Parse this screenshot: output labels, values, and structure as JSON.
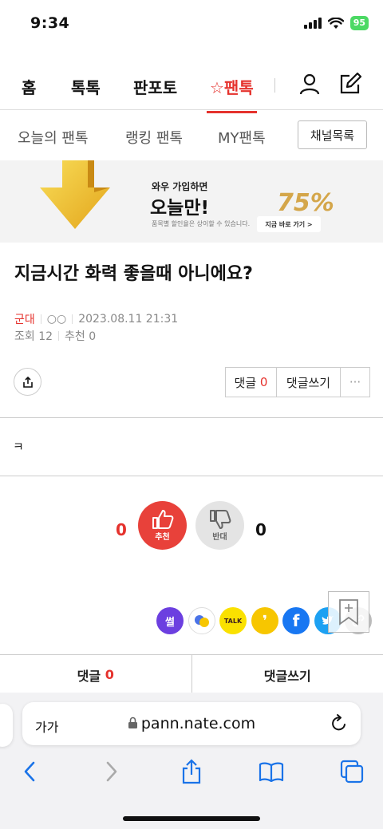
{
  "status_bar": {
    "time": "9:34",
    "battery": "95"
  },
  "top_nav": {
    "items": [
      {
        "label": "홈"
      },
      {
        "label": "톡톡"
      },
      {
        "label": "판포토"
      },
      {
        "label": "☆팬톡"
      }
    ]
  },
  "sub_nav": {
    "items": [
      {
        "label": "오늘의 팬톡"
      },
      {
        "label": "랭킹 팬톡"
      },
      {
        "label": "MY팬톡"
      }
    ],
    "channel_list_button": "채널목록"
  },
  "banner": {
    "line1": "와우 가입하면",
    "line2": "오늘만!",
    "line3": "품목별 할인율은 상이할 수 있습니다.",
    "percent": "75%",
    "button": "지금 바로 가기 >"
  },
  "post": {
    "title": "지금시간 화력 좋을때 아니에요?",
    "category": "군대",
    "author": "○○",
    "datetime": "2023.08.11 21:31",
    "views_label": "조회 12",
    "recommend_label": "추천 0",
    "body": "ㅋ"
  },
  "actions": {
    "comment_label": "댓글",
    "comment_count": "0",
    "write_comment": "댓글쓰기",
    "more": "···"
  },
  "votes": {
    "up_count": "0",
    "up_label": "추천",
    "down_label": "반대",
    "down_count": "0"
  },
  "social": {
    "items": [
      {
        "label": "썰",
        "color": "#6c3fe0"
      },
      {
        "label": "",
        "color": "#4a73e8"
      },
      {
        "label": "TALK",
        "color": "#fae100"
      },
      {
        "label": "❜",
        "color": "#f7c600"
      },
      {
        "label": "f",
        "color": "#1877f2"
      },
      {
        "label": "",
        "color": "#1da1f2"
      }
    ]
  },
  "bottom_bar": {
    "comment_label": "댓글",
    "comment_count": "0",
    "write_comment": "댓글쓰기"
  },
  "browser": {
    "aa": "가가",
    "url": "pann.nate.com"
  },
  "colors": {
    "accent": "#e5322d"
  }
}
